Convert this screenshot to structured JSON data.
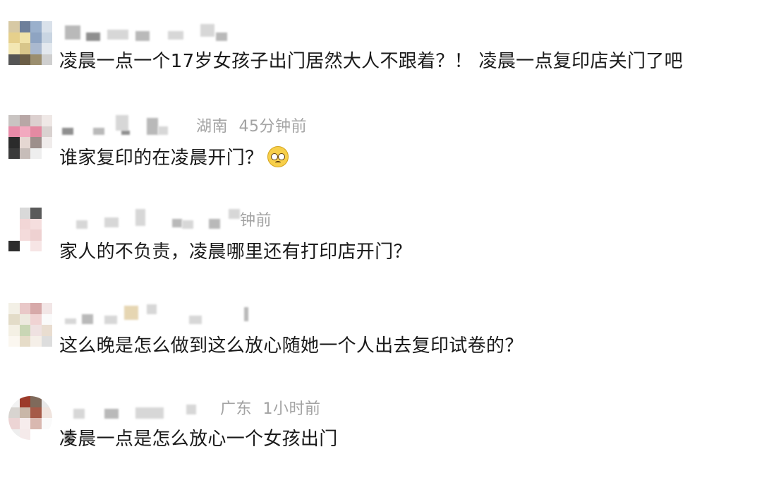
{
  "comments": [
    {
      "location": "",
      "time": "",
      "text": "凌晨一点一个17岁女孩子出门居然大人不跟着？！ 凌晨一点复印店关门了吧"
    },
    {
      "location": "湖南",
      "time": "45分钟前",
      "text": "谁家复印的在凌晨开门？",
      "emoji": "pleading-face-icon"
    },
    {
      "location": "",
      "time": "钟前",
      "text": "家人的不负责，凌晨哪里还有打印店开门？"
    },
    {
      "location": "",
      "time": "",
      "text": "这么晚是怎么做到这么放心随她一个人出去复印试卷的？"
    },
    {
      "location": "广东",
      "time": "1小时前",
      "text": "凌晨一点是怎么放心一个女孩出门"
    }
  ]
}
